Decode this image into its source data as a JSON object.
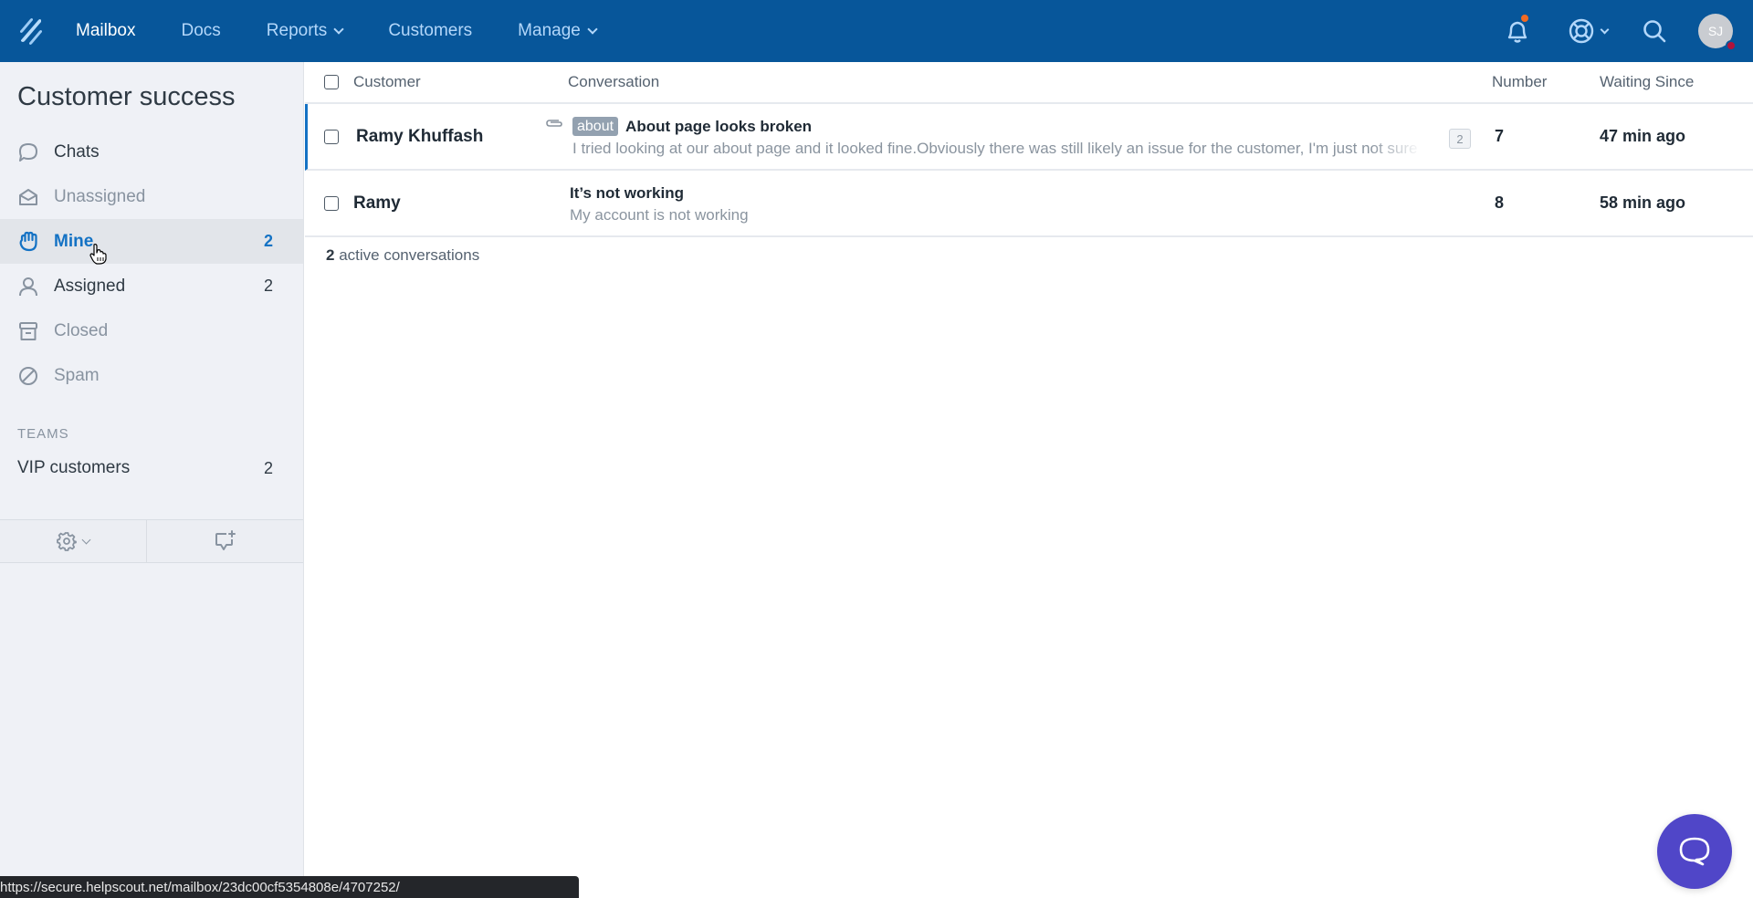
{
  "topbar": {
    "logo": "helpscout-logo-icon",
    "nav": [
      {
        "label": "Mailbox",
        "active": true,
        "dropdown": false
      },
      {
        "label": "Docs",
        "active": false,
        "dropdown": false
      },
      {
        "label": "Reports",
        "active": false,
        "dropdown": true
      },
      {
        "label": "Customers",
        "active": false,
        "dropdown": false
      },
      {
        "label": "Manage",
        "active": false,
        "dropdown": true
      }
    ],
    "notifications_icon": "bell-icon",
    "notification_dot_color": "#f26a22",
    "help_icon": "lifebuoy-icon",
    "search_icon": "search-icon",
    "avatar_initials": "SJ",
    "avatar_status_color": "#b0133b"
  },
  "sidebar": {
    "title": "Customer success",
    "folders": [
      {
        "label": "Chats",
        "icon": "chat-bubble-icon",
        "count": "",
        "state": "normal"
      },
      {
        "label": "Unassigned",
        "icon": "open-envelope-icon",
        "count": "",
        "state": "muted"
      },
      {
        "label": "Mine",
        "icon": "raised-hand-icon",
        "count": "2",
        "state": "active"
      },
      {
        "label": "Assigned",
        "icon": "person-icon",
        "count": "2",
        "state": "normal"
      },
      {
        "label": "Closed",
        "icon": "archive-box-icon",
        "count": "",
        "state": "muted"
      },
      {
        "label": "Spam",
        "icon": "prohibited-icon",
        "count": "",
        "state": "muted"
      }
    ],
    "teams_heading": "TEAMS",
    "teams": [
      {
        "label": "VIP customers",
        "count": "2"
      }
    ],
    "footer": {
      "settings_icon": "gear-icon",
      "new_conversation_icon": "new-chat-plus-icon"
    }
  },
  "table": {
    "columns": {
      "customer": "Customer",
      "conversation": "Conversation",
      "number": "Number",
      "waiting": "Waiting Since"
    },
    "rows": [
      {
        "customer": "Ramy Khuffash",
        "has_attachment": true,
        "tag": "about",
        "subject": "About page looks broken",
        "preview": "I tried looking at our about page and it looked fine.Obviously there was still likely an issue for the customer, I'm just not sure what it is",
        "thread_count": "2",
        "number": "7",
        "waiting": "47 min ago"
      },
      {
        "customer": "Ramy",
        "has_attachment": false,
        "tag": "",
        "subject": "It’s not working",
        "preview": "My account is not working",
        "thread_count": "",
        "number": "8",
        "waiting": "58 min ago"
      }
    ],
    "summary_count": "2",
    "summary_text": " active conversations"
  },
  "status_bar_url": "https://secure.helpscout.net/mailbox/23dc00cf5354808e/4707252/",
  "beacon": {
    "icon": "chat-bubble-icon",
    "color": "#5046c8"
  }
}
